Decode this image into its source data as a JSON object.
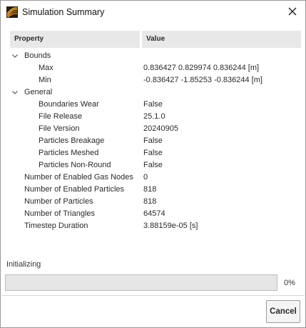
{
  "window": {
    "title": "Simulation Summary"
  },
  "table": {
    "headers": {
      "property": "Property",
      "value": "Value"
    },
    "rows": [
      {
        "label": "Bounds",
        "value": "",
        "level": 0,
        "expandable": true
      },
      {
        "label": "Max",
        "value": "0.836427 0.829974 0.836244 [m]",
        "level": 1,
        "expandable": false
      },
      {
        "label": "Min",
        "value": "-0.836427 -1.85253 -0.836244 [m]",
        "level": 1,
        "expandable": false
      },
      {
        "label": "General",
        "value": "",
        "level": 0,
        "expandable": true
      },
      {
        "label": "Boundaries Wear",
        "value": "False",
        "level": 1,
        "expandable": false
      },
      {
        "label": "File Release",
        "value": "25.1.0",
        "level": 1,
        "expandable": false
      },
      {
        "label": "File Version",
        "value": "20240905",
        "level": 1,
        "expandable": false
      },
      {
        "label": "Particles Breakage",
        "value": "False",
        "level": 1,
        "expandable": false
      },
      {
        "label": "Particles Meshed",
        "value": "False",
        "level": 1,
        "expandable": false
      },
      {
        "label": "Particles Non-Round",
        "value": "False",
        "level": 1,
        "expandable": false
      },
      {
        "label": "Number of Enabled Gas Nodes",
        "value": "0",
        "level": 0,
        "expandable": false
      },
      {
        "label": "Number of Enabled Particles",
        "value": "818",
        "level": 0,
        "expandable": false
      },
      {
        "label": "Number of Particles",
        "value": "818",
        "level": 0,
        "expandable": false
      },
      {
        "label": "Number of Triangles",
        "value": "64574",
        "level": 0,
        "expandable": false
      },
      {
        "label": "Timestep Duration",
        "value": "3.88159e-05 [s]",
        "level": 0,
        "expandable": false
      }
    ]
  },
  "status": {
    "label": "Initializing",
    "progress_fraction": 0,
    "progress_text": "0%"
  },
  "buttons": {
    "cancel": "Cancel"
  },
  "icons": {
    "app": "rocky-app-icon",
    "close": "close-icon",
    "expand": "chevron-down-icon"
  },
  "colors": {
    "app_icon_orange": "#e8a020",
    "app_icon_dark": "#2a1a10",
    "header_bg": "#e8e8e8",
    "progress_track": "#e6e6e6"
  }
}
